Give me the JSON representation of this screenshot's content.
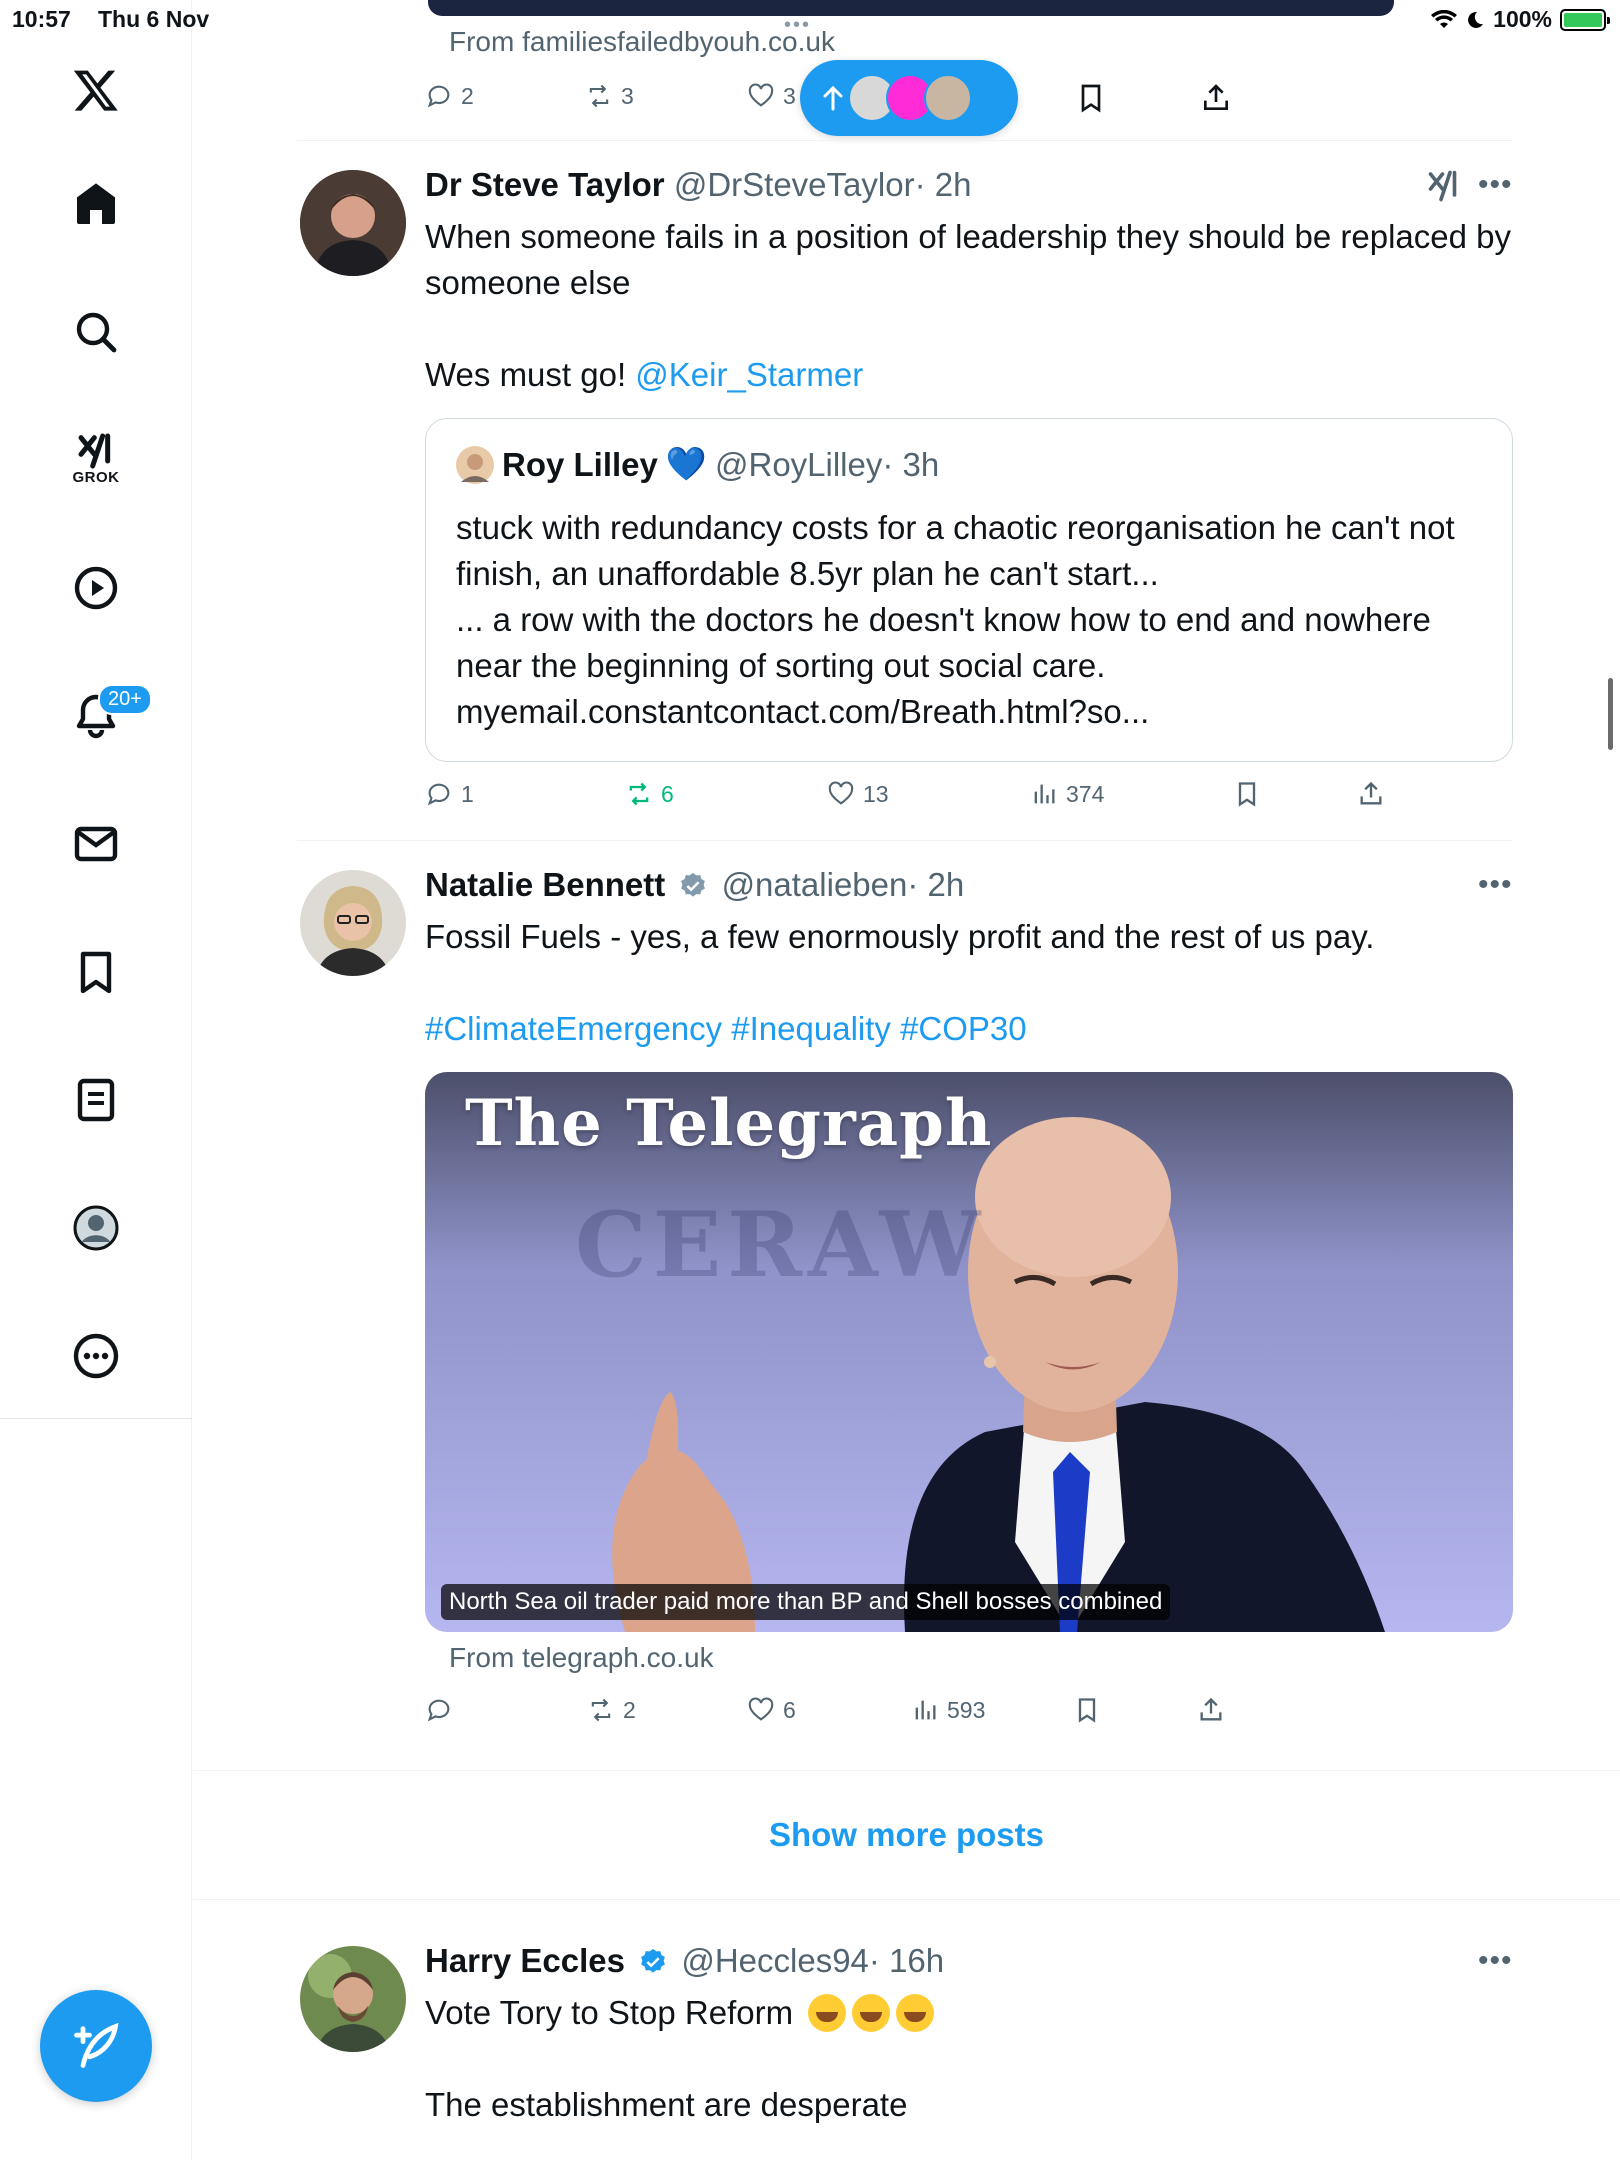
{
  "status_bar": {
    "time": "10:57",
    "date": "Thu 6 Nov",
    "battery": "100%"
  },
  "sidebar": {
    "grok_label": "GROK",
    "notification_badge": "20+"
  },
  "top_tweet": {
    "from": "From familiesfailedbyouh.co.uk",
    "replies": "2",
    "reposts": "3",
    "likes": "3"
  },
  "tweets": [
    {
      "name": "Dr Steve Taylor",
      "handle": "@DrSteveTaylor",
      "time": "· 2h",
      "text_line1": "When someone fails in a position of leadership they should be replaced by someone else",
      "text_line2_prefix": "Wes must go! ",
      "text_line2_mention": "@Keir_Starmer",
      "quote": {
        "name": "Roy Lilley",
        "heart": "💙",
        "handle": "@RoyLilley",
        "time": "· 3h",
        "text": "stuck with redundancy costs for a chaotic reorganisation he can't not finish, an unaffordable 8.5yr plan he can't start...\n... a row with the doctors he doesn't know how to end and nowhere near the beginning of sorting out social care.\nmyemail.constantcontact.com/Breath.html?so..."
      },
      "replies": "1",
      "reposts": "6",
      "likes": "13",
      "views": "374"
    },
    {
      "name": "Natalie Bennett",
      "handle": "@natalieben",
      "time": "· 2h",
      "text_line1": "Fossil Fuels - yes, a few enormously profit and the rest of us pay.",
      "hashtags": "#ClimateEmergency #Inequality #COP30",
      "media": {
        "masthead": "The Telegraph",
        "background_text": "CERAW",
        "caption": "North Sea oil trader paid more than BP and Shell bosses combined"
      },
      "from": "From telegraph.co.uk",
      "replies": "",
      "reposts": "2",
      "likes": "6",
      "views": "593"
    },
    {
      "name": "Harry Eccles",
      "handle": "@Heccles94",
      "time": "· 16h",
      "text_line1": "Vote Tory to Stop Reform",
      "text_line2": "The establishment are desperate"
    }
  ],
  "show_more": "Show more posts",
  "colors": {
    "accent": "#1d9bf0",
    "repost_active": "#00ba7c",
    "text_primary": "#0f1419",
    "text_secondary": "#536471"
  }
}
